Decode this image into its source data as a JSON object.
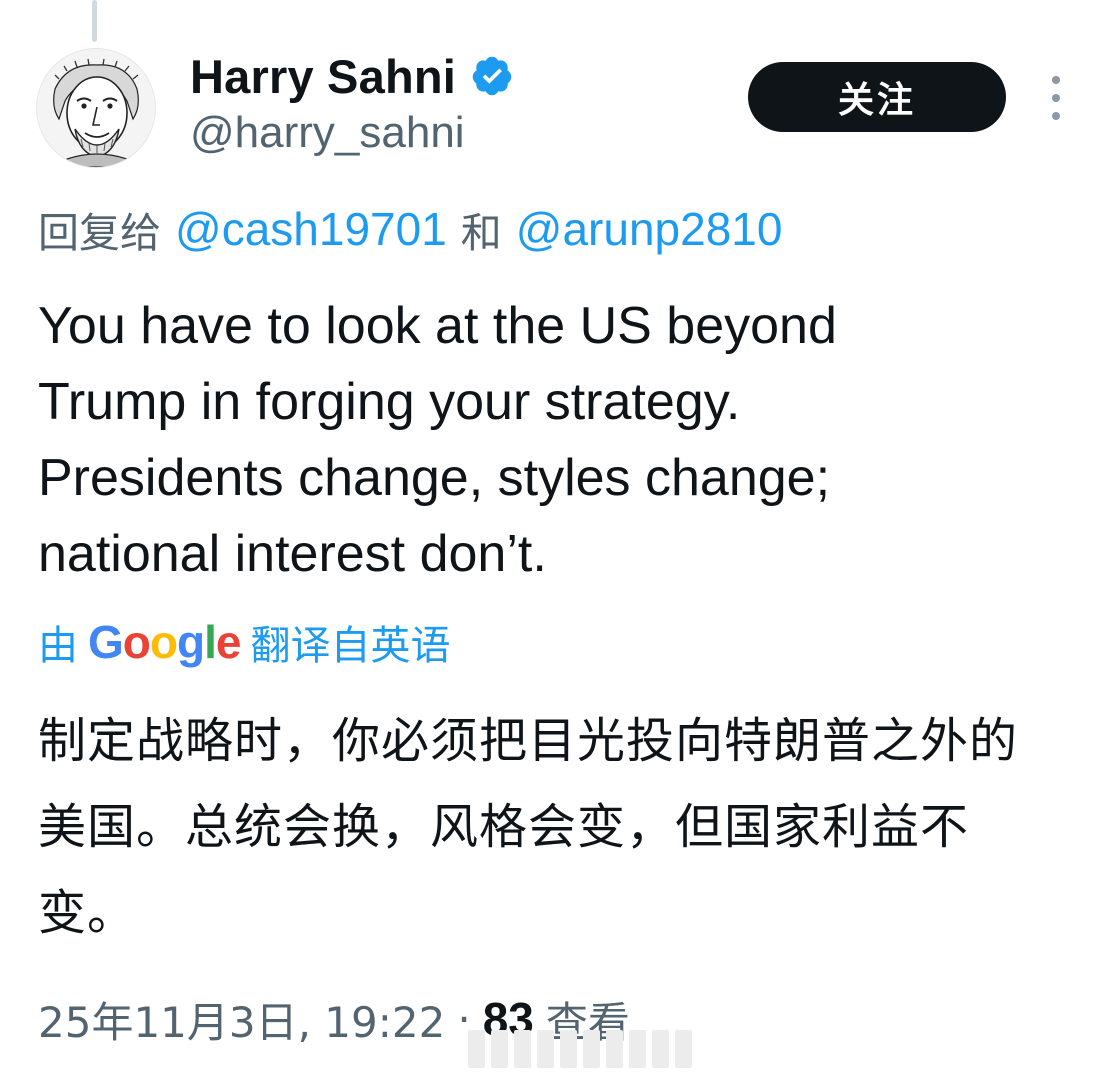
{
  "author": {
    "display_name": "Harry Sahni",
    "handle": "@harry_sahni",
    "verified": true,
    "avatar_icon": "avatar-caricature-icon"
  },
  "actions": {
    "follow_label": "关注",
    "more_icon": "more-vertical-icon"
  },
  "reply_context": {
    "prefix": "回复给",
    "mentions": [
      "@cash19701",
      "@arunp2810"
    ],
    "joiner": "和"
  },
  "tweet": {
    "text": "You have to look at the US beyond\nTrump in forging your strategy.\nPresidents change, styles change;\nnational interest don’t."
  },
  "translation": {
    "by": "由",
    "provider": "Google",
    "source_label": "翻译自英语",
    "text": "制定战略时，你必须把目光投向特朗普之外的美国。总统会换，风格会变，但国家利益不变。"
  },
  "meta": {
    "timestamp": "25年11月3日, 19:22",
    "separator": "·",
    "views_count": "83",
    "views_label": "查看"
  },
  "colors": {
    "accent": "#1d9bf0",
    "text_primary": "#0f1419",
    "text_secondary": "#536471",
    "button_bg": "#0f1419",
    "google_blue": "#4285F4",
    "google_red": "#EA4335",
    "google_yellow": "#FBBC05",
    "google_green": "#34A853"
  }
}
